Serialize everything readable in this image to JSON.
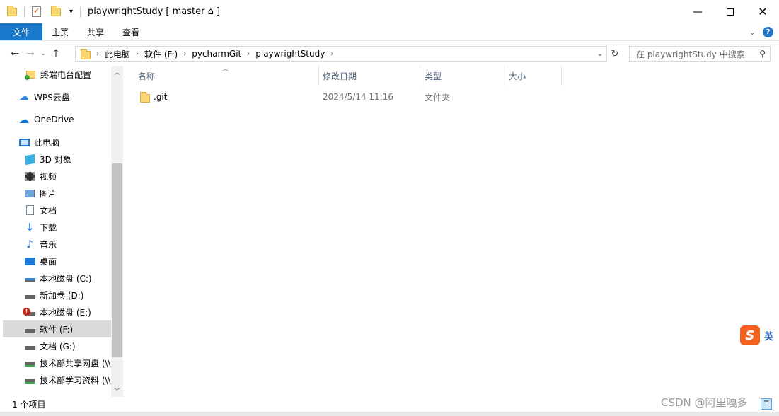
{
  "window": {
    "title": "playwrightStudy [ master ⌂ ]",
    "minimize_icon": "minimize-icon",
    "maximize_icon": "maximize-icon",
    "close_icon": "close-icon"
  },
  "ribbon": {
    "tabs": [
      {
        "label": "文件"
      },
      {
        "label": "主页"
      },
      {
        "label": "共享"
      },
      {
        "label": "查看"
      }
    ]
  },
  "address": {
    "crumbs": [
      "此电脑",
      "软件 (F:)",
      "pycharmGit",
      "playwrightStudy"
    ],
    "search_placeholder": "在 playwrightStudy 中搜索"
  },
  "nav": {
    "items": [
      {
        "label": "终端电台配置",
        "icon": "shortcut-folder-icon"
      },
      {
        "label": "WPS云盘",
        "icon": "wps-cloud-icon"
      },
      {
        "label": "OneDrive",
        "icon": "onedrive-icon"
      },
      {
        "label": "此电脑",
        "icon": "this-pc-icon"
      },
      {
        "label": "3D 对象",
        "icon": "3d-objects-icon"
      },
      {
        "label": "视频",
        "icon": "videos-icon"
      },
      {
        "label": "图片",
        "icon": "pictures-icon"
      },
      {
        "label": "文档",
        "icon": "documents-icon"
      },
      {
        "label": "下载",
        "icon": "downloads-icon"
      },
      {
        "label": "音乐",
        "icon": "music-icon"
      },
      {
        "label": "桌面",
        "icon": "desktop-icon"
      },
      {
        "label": "本地磁盘 (C:)",
        "icon": "system-drive-icon"
      },
      {
        "label": "新加卷 (D:)",
        "icon": "drive-icon"
      },
      {
        "label": "本地磁盘 (E:)",
        "icon": "drive-error-icon"
      },
      {
        "label": "软件 (F:)",
        "icon": "drive-icon",
        "selected": true
      },
      {
        "label": "文档 (G:)",
        "icon": "drive-icon"
      },
      {
        "label": "技术部共享网盘 (\\\\",
        "icon": "network-drive-icon"
      },
      {
        "label": "技术部学习资料 (\\\\",
        "icon": "network-drive-icon"
      }
    ]
  },
  "columns": {
    "name": "名称",
    "modified": "修改日期",
    "type": "类型",
    "size": "大小"
  },
  "files": [
    {
      "name": ".git",
      "modified": "2024/5/14 11:16",
      "type": "文件夹",
      "size": ""
    }
  ],
  "status": {
    "count": "1 个项目"
  },
  "ime": {
    "logo": "S",
    "lang": "英"
  },
  "watermark": "CSDN @阿里嘎多"
}
